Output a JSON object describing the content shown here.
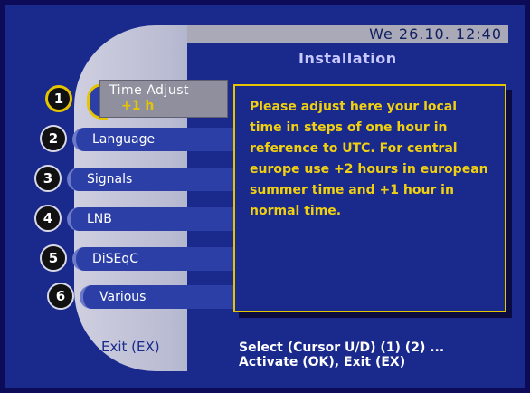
{
  "header": {
    "datetime": "We 26.10.   12:40",
    "title": "Installation"
  },
  "menu": {
    "items": [
      {
        "number": "1",
        "label": "Time Adjust",
        "value": "+1 h"
      },
      {
        "number": "2",
        "label": "Language"
      },
      {
        "number": "3",
        "label": "Signals"
      },
      {
        "number": "4",
        "label": "LNB"
      },
      {
        "number": "5",
        "label": "DiSEqC"
      },
      {
        "number": "6",
        "label": "Various"
      }
    ]
  },
  "help_text": "Please adjust here your local time in steps of one hour in reference to UTC. For central europe use +2 hours in european summer time and +1 hour in normal time.",
  "footer": {
    "exit_label": "Exit (EX)",
    "instructions_line1": "Select (Cursor U/D) (1) (2) ...",
    "instructions_line2": "Activate (OK), Exit (EX)"
  },
  "colors": {
    "background": "#1a2a8c",
    "accent_yellow": "#e6c400",
    "silver": "#b9bbd2"
  }
}
